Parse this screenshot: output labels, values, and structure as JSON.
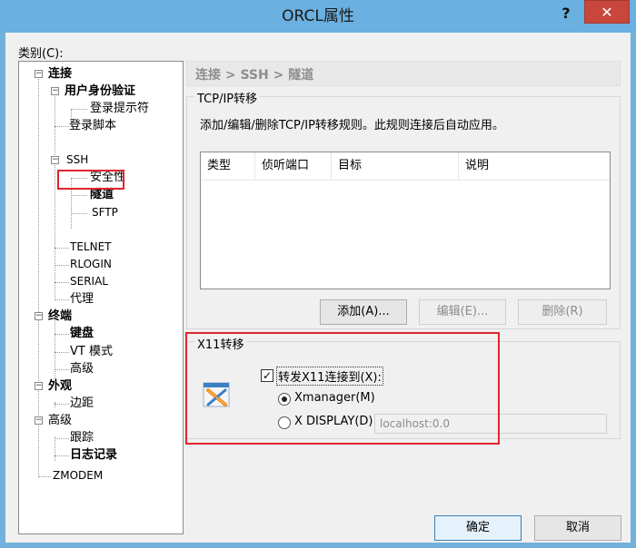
{
  "window": {
    "title": "ORCL属性",
    "help_label": "?",
    "close_label": "✕"
  },
  "category_label": "类别(C):",
  "tree": {
    "items": [
      {
        "label": "连接",
        "bold": true,
        "expander": "⊟"
      },
      {
        "label": "用户身份验证",
        "bold": true,
        "expander": "⊟"
      },
      {
        "label": "登录提示符",
        "bold": false
      },
      {
        "label": "登录脚本",
        "bold": false
      },
      {
        "label": "SSH",
        "bold": false,
        "expander": "⊟"
      },
      {
        "label": "安全性",
        "bold": false
      },
      {
        "label": "隧道",
        "bold": true
      },
      {
        "label": "SFTP",
        "bold": false
      },
      {
        "label": "TELNET",
        "bold": false
      },
      {
        "label": "RLOGIN",
        "bold": false
      },
      {
        "label": "SERIAL",
        "bold": false
      },
      {
        "label": "代理",
        "bold": false
      },
      {
        "label": "终端",
        "bold": true,
        "expander": "⊟"
      },
      {
        "label": "键盘",
        "bold": true
      },
      {
        "label": "VT 模式",
        "bold": false
      },
      {
        "label": "高级",
        "bold": false
      },
      {
        "label": "外观",
        "bold": true,
        "expander": "⊟"
      },
      {
        "label": "边距",
        "bold": false
      },
      {
        "label": "高级",
        "bold": false,
        "expander": "⊟"
      },
      {
        "label": "跟踪",
        "bold": false
      },
      {
        "label": "日志记录",
        "bold": true
      },
      {
        "label": "ZMODEM",
        "bold": false
      }
    ]
  },
  "breadcrumb": "连接 > SSH > 隧道",
  "tcp_group": {
    "title": "TCP/IP转移",
    "description": "添加/编辑/删除TCP/IP转移规则。此规则连接后自动应用。",
    "columns": [
      "类型",
      "侦听端口",
      "目标",
      "说明"
    ],
    "add_label": "添加(A)...",
    "edit_label": "编辑(E)...",
    "delete_label": "删除(R)"
  },
  "x11_group": {
    "title": "X11转移",
    "forward_label": "转发X11连接到(X):",
    "forward_checked": true,
    "xmanager_label": "Xmanager(M)",
    "xdisplay_label": "X DISPLAY(D):",
    "xdisplay_value": "localhost:0.0",
    "selected": "xmanager"
  },
  "footer": {
    "ok_label": "确定",
    "cancel_label": "取消"
  },
  "colors": {
    "titlebar": "#6ab0e0",
    "close": "#c8463c",
    "highlight": "#e0242c"
  }
}
